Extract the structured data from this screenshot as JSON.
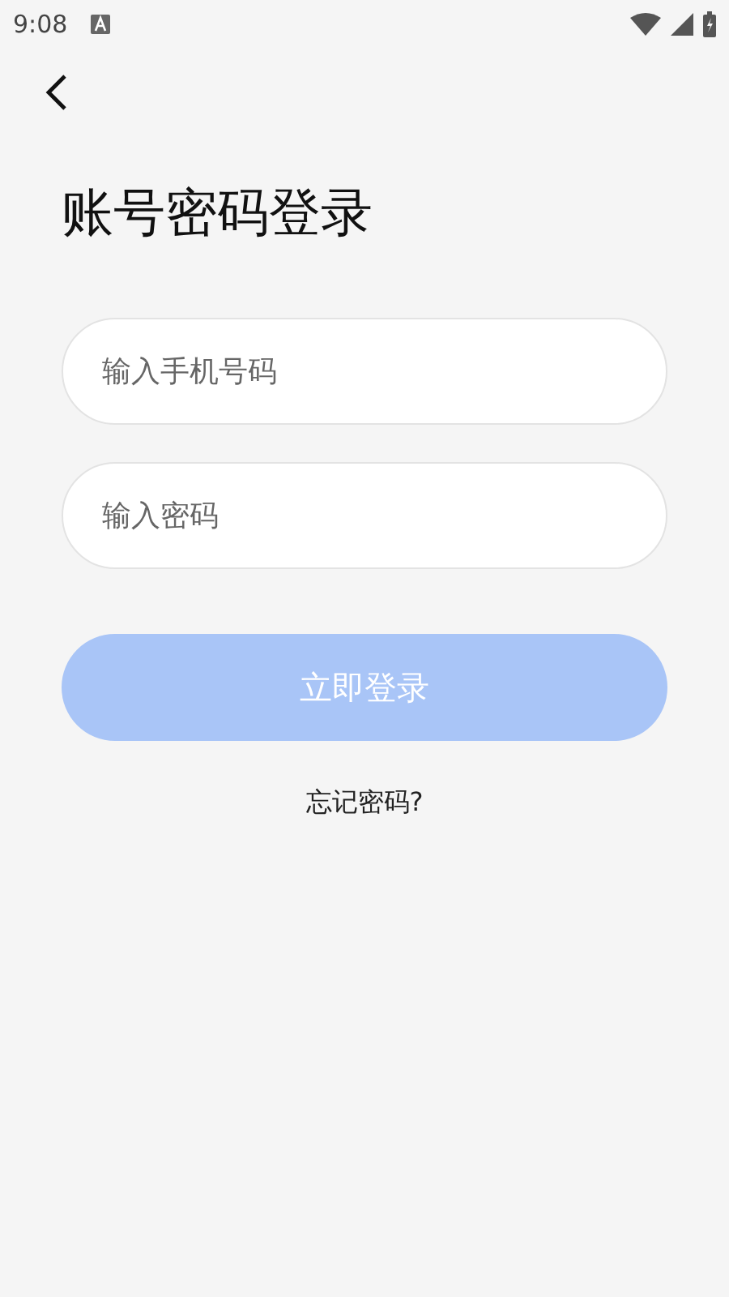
{
  "status_bar": {
    "time": "9:08"
  },
  "title": "账号密码登录",
  "fields": [
    {
      "placeholder": "输入手机号码"
    },
    {
      "placeholder": "输入密码"
    }
  ],
  "login_button": {
    "label": "立即登录",
    "disabled": true
  },
  "forgot_link": "忘记密码?"
}
